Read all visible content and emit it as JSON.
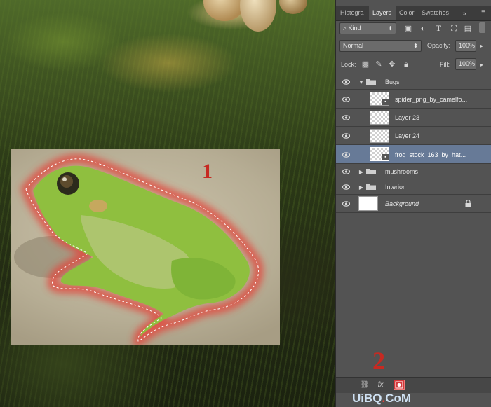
{
  "panel": {
    "tabs": [
      {
        "label": "Histogra",
        "active": false
      },
      {
        "label": "Layers",
        "active": true
      },
      {
        "label": "Color",
        "active": false
      },
      {
        "label": "Swatches",
        "active": false
      }
    ],
    "filter": {
      "kind_label": "Kind"
    },
    "blend_mode": "Normal",
    "opacity": {
      "label": "Opacity:",
      "value": "100%"
    },
    "lock": {
      "label": "Lock:"
    },
    "fill": {
      "label": "Fill:",
      "value": "100%"
    },
    "layers": [
      {
        "name": "Bugs",
        "type": "group",
        "expanded": true,
        "selected": false
      },
      {
        "name": "spider_png_by_camelfo...",
        "type": "smart-object",
        "selected": false
      },
      {
        "name": "Layer 23",
        "type": "layer",
        "selected": false
      },
      {
        "name": "Layer 24",
        "type": "layer",
        "selected": false
      },
      {
        "name": "frog_stock_163_by_hat...",
        "type": "smart-object",
        "selected": true
      },
      {
        "name": "mushrooms",
        "type": "group",
        "expanded": false,
        "selected": false
      },
      {
        "name": "Interior",
        "type": "group",
        "expanded": false,
        "selected": false
      },
      {
        "name": "Background",
        "type": "background",
        "selected": false,
        "locked": true
      }
    ],
    "bottom_icons": [
      "link-icon",
      "fx-icon",
      "add-mask-icon"
    ],
    "bottom_fx_label": "fx."
  },
  "annotations": {
    "step1": "1",
    "step2": "2"
  },
  "watermark": {
    "text_prefix": "UiBQ",
    "text_dot": ".",
    "text_suffix": "CoM"
  },
  "colors": {
    "panel_bg": "#535353",
    "selected_layer": "#677a97",
    "annotation_red": "#c62a22",
    "selection_glow": "#e2473c"
  }
}
